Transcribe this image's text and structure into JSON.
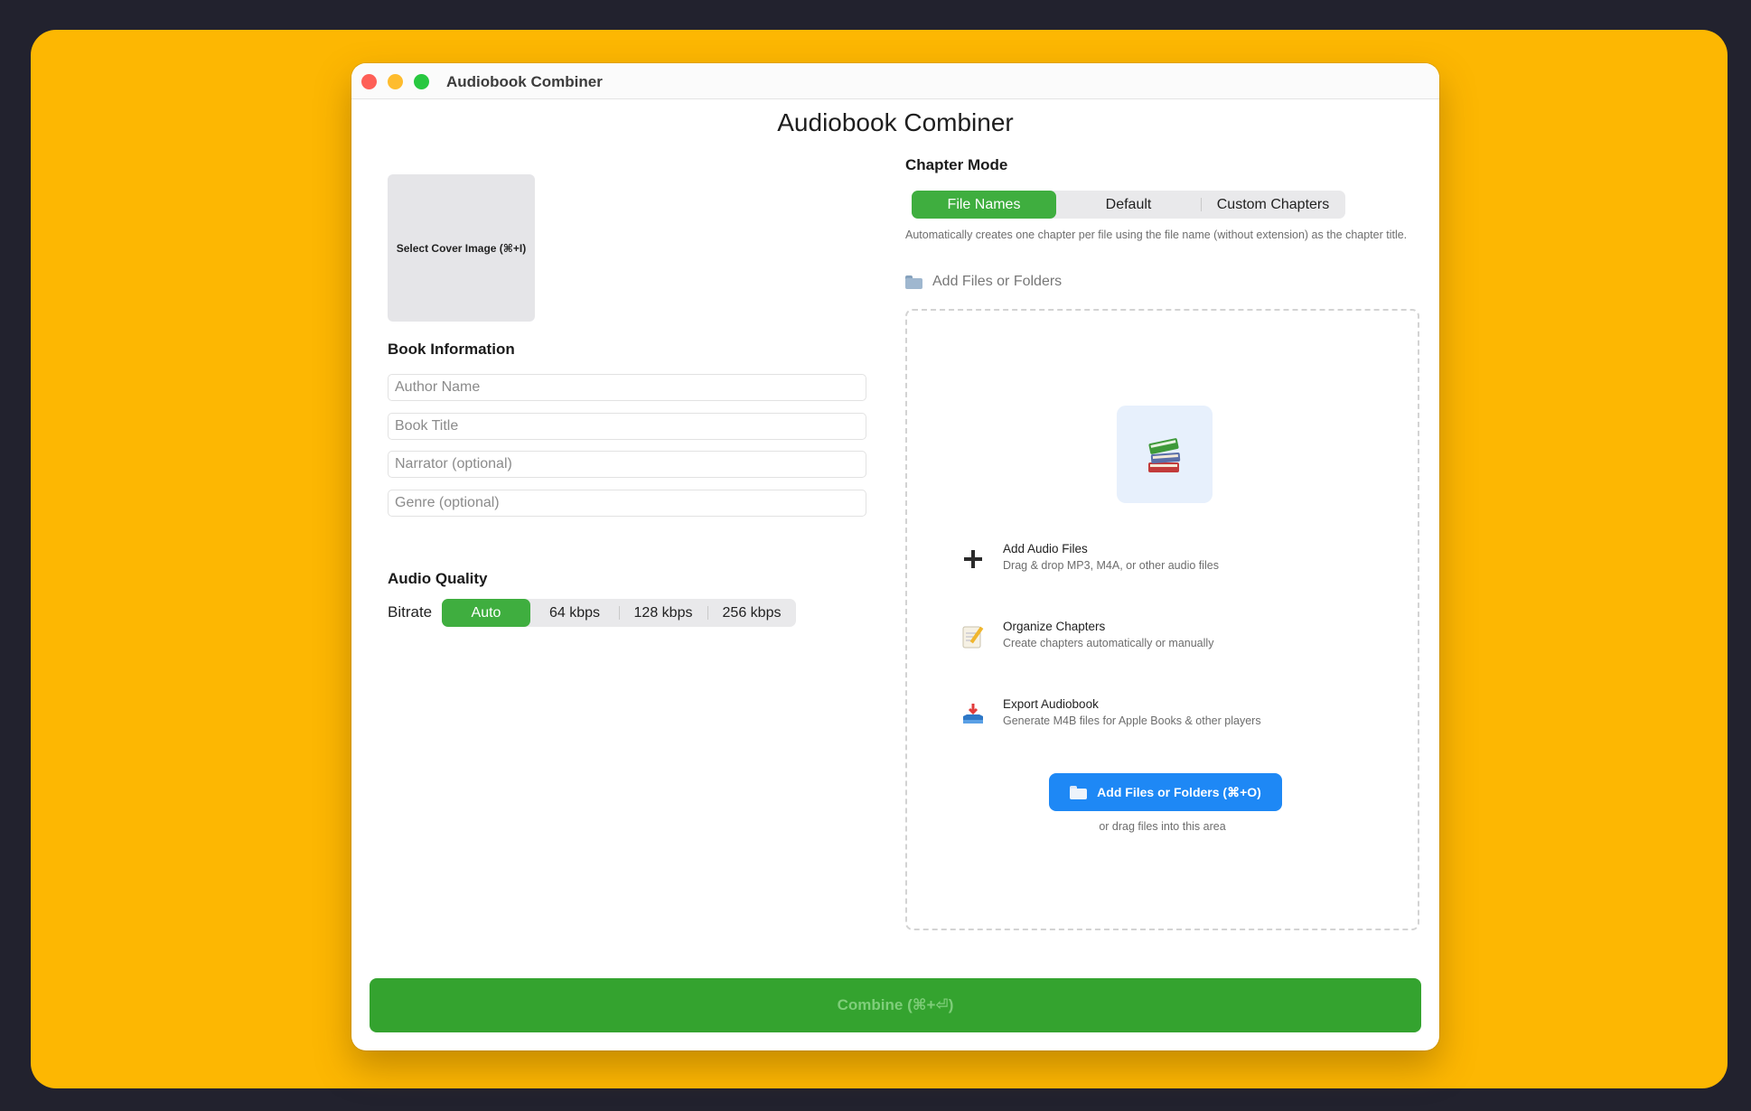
{
  "window": {
    "title": "Audiobook Combiner",
    "heading": "Audiobook Combiner"
  },
  "cover": {
    "label": "Select Cover Image (⌘+I)"
  },
  "book_info": {
    "heading": "Book Information",
    "fields": [
      {
        "placeholder": "Author Name",
        "value": ""
      },
      {
        "placeholder": "Book Title",
        "value": ""
      },
      {
        "placeholder": "Narrator (optional)",
        "value": ""
      },
      {
        "placeholder": "Genre (optional)",
        "value": ""
      }
    ]
  },
  "audio_quality": {
    "heading": "Audio Quality",
    "bitrate_label": "Bitrate",
    "options": [
      "Auto",
      "64 kbps",
      "128 kbps",
      "256 kbps"
    ],
    "selected": "Auto"
  },
  "chapter_mode": {
    "heading": "Chapter Mode",
    "options": [
      "File Names",
      "Default",
      "Custom Chapters"
    ],
    "selected": "File Names",
    "description": "Automatically creates one chapter per file using the file name (without extension) as the chapter title."
  },
  "add_files_header": "Add Files or Folders",
  "dropzone": {
    "icon": "books-icon",
    "features": [
      {
        "icon": "plus-icon",
        "title": "Add Audio Files",
        "subtitle": "Drag & drop MP3, M4A, or other audio files"
      },
      {
        "icon": "memo-icon",
        "title": "Organize Chapters",
        "subtitle": "Create chapters automatically or manually"
      },
      {
        "icon": "inbox-tray-icon",
        "title": "Export Audiobook",
        "subtitle": "Generate M4B files for Apple Books & other players"
      }
    ],
    "button_label": "Add Files or Folders (⌘+O)",
    "hint": "or drag files into this area"
  },
  "combine_button": {
    "label": "Combine (⌘+⏎)"
  },
  "colors": {
    "backdrop": "#fdb702",
    "accent_green": "#3fae3f",
    "combine_green": "#34a32f",
    "primary_blue": "#1e88f5"
  }
}
